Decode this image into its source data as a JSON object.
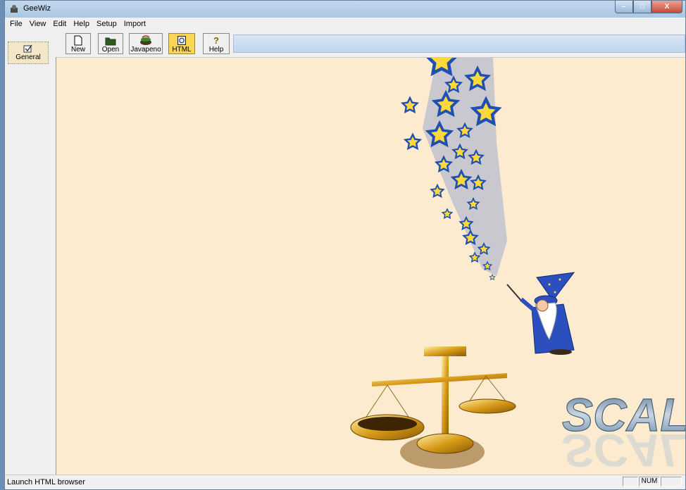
{
  "window": {
    "title": "GeeWiz"
  },
  "menu": [
    "File",
    "View",
    "Edit",
    "Help",
    "Setup",
    "Import"
  ],
  "toolbar": {
    "new_label": "New",
    "open_label": "Open",
    "javapeno_label": "Javapeno",
    "html_label": "HTML",
    "help_label": "Help"
  },
  "sidebar": {
    "general_label": "General"
  },
  "splash": {
    "logo_text": "SCALE"
  },
  "status": {
    "text": "Launch HTML browser",
    "num_indicator": "NUM"
  },
  "colors": {
    "canvas": "#fdebd0",
    "active_button": "#f9d556",
    "star": "#ffd93a",
    "star_outline": "#1f4fb0"
  }
}
